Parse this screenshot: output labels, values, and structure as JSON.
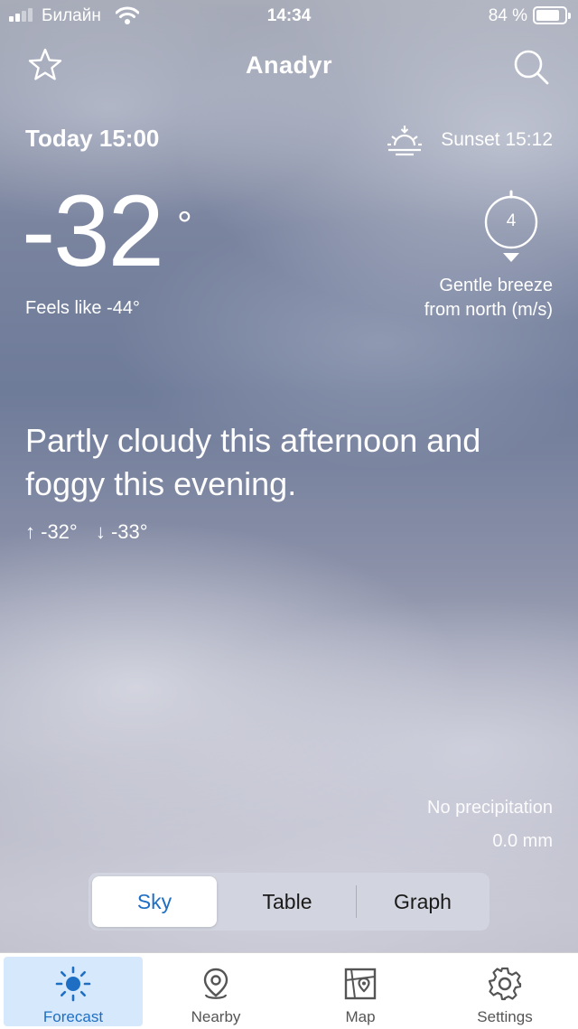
{
  "status_bar": {
    "carrier": "Билайн",
    "time": "14:34",
    "battery_percent": "84 %",
    "battery_level": 0.84
  },
  "header": {
    "city": "Anadyr",
    "favorite_icon": "star-icon",
    "search_icon": "search-icon"
  },
  "forecast": {
    "time_label": "Today 15:00",
    "sunset": "Sunset 15:12",
    "temperature": "-32",
    "degree_symbol": "°",
    "feels_like": "Feels like -44°",
    "wind_speed": "4",
    "wind_desc_line1": "Gentle breeze",
    "wind_desc_line2": "from north (m/s)",
    "summary": "Partly cloudy this afternoon and foggy this evening.",
    "max": "↑ -32°",
    "min": "↓ -33°",
    "precip_label": "No precipitation",
    "precip_amount": "0.0 mm"
  },
  "view_switch": {
    "options": [
      "Sky",
      "Table",
      "Graph"
    ],
    "selected": "Sky"
  },
  "tabbar": {
    "items": [
      {
        "label": "Forecast",
        "icon": "sun-icon"
      },
      {
        "label": "Nearby",
        "icon": "location-pin-icon"
      },
      {
        "label": "Map",
        "icon": "map-icon"
      },
      {
        "label": "Settings",
        "icon": "gear-icon"
      }
    ],
    "active": "Forecast"
  },
  "colors": {
    "accent": "#1e6fc4",
    "active_tab_bg": "#d6e8fb"
  }
}
